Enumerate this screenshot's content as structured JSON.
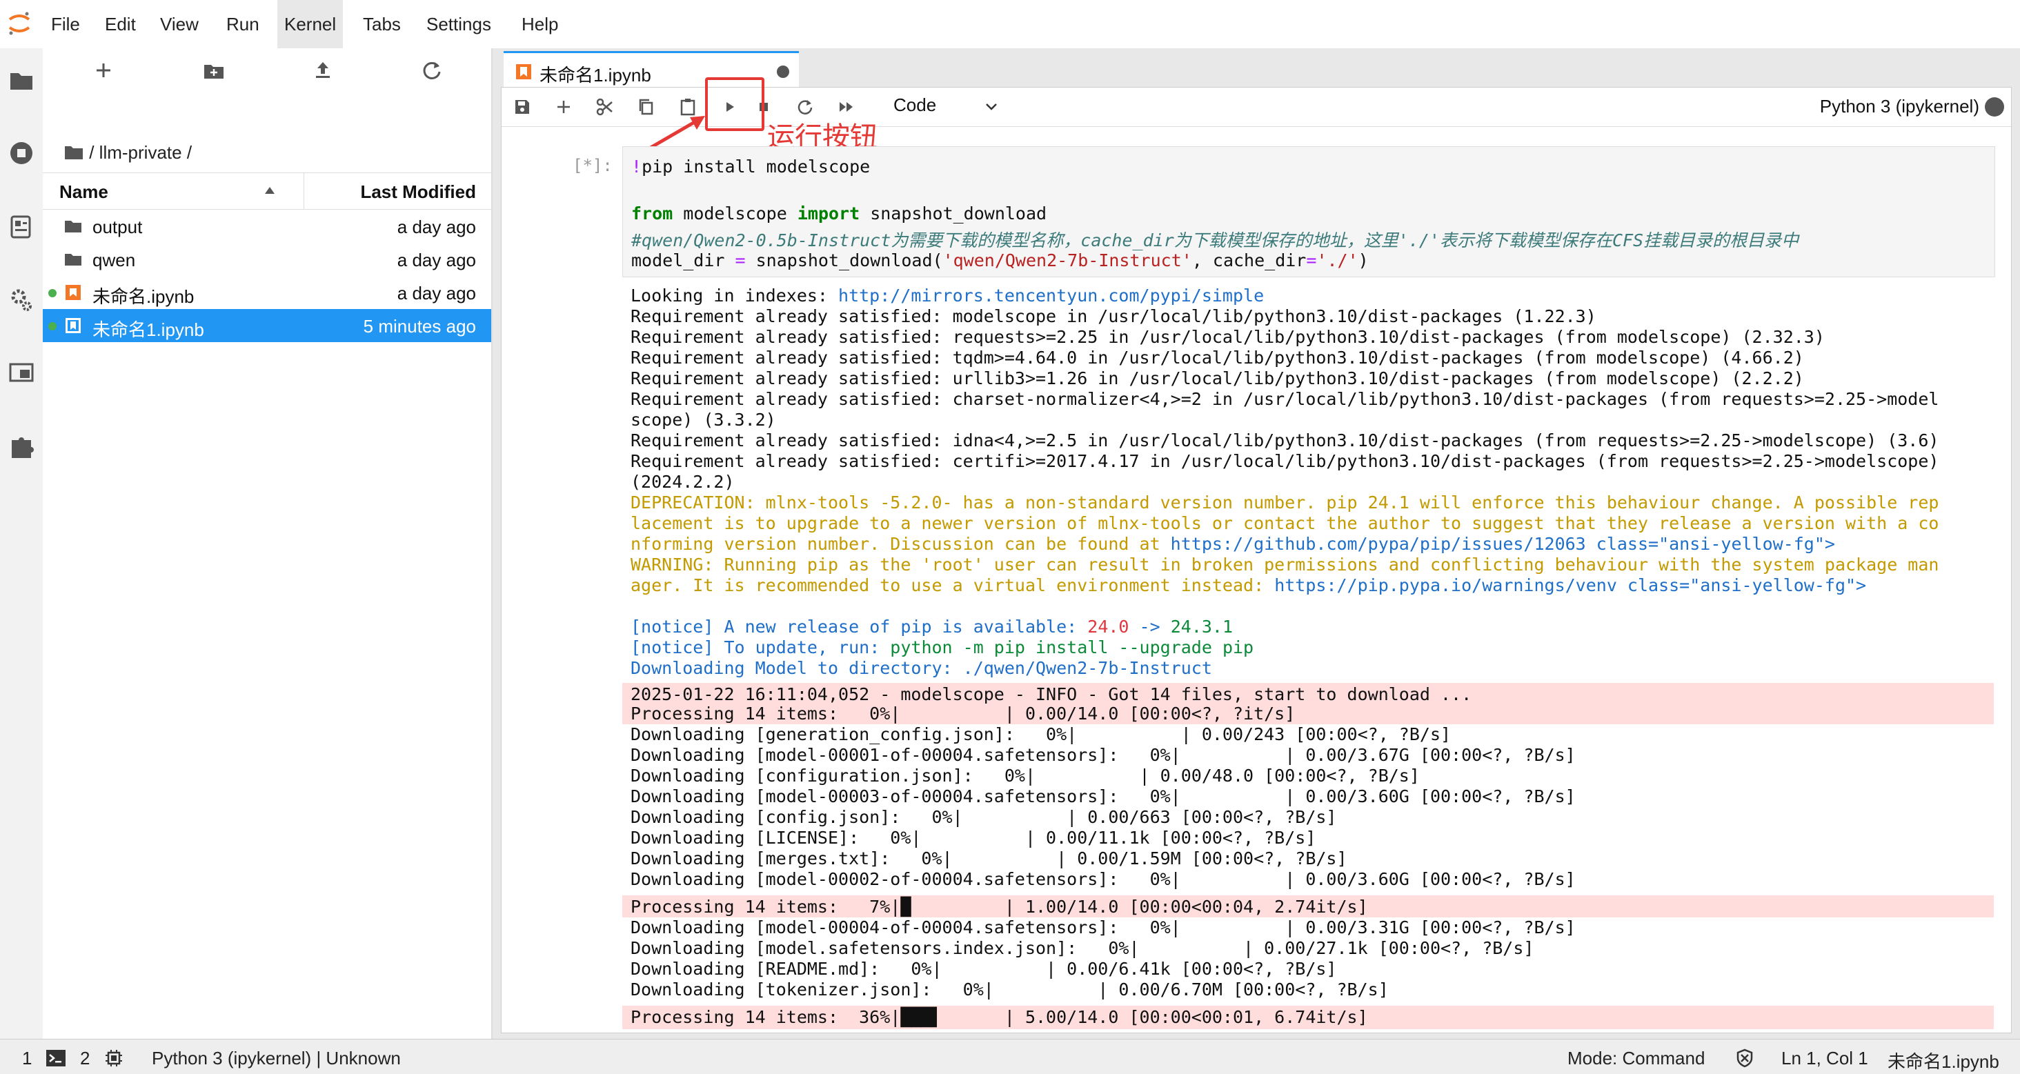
{
  "menubar": {
    "items": [
      "File",
      "Edit",
      "View",
      "Run",
      "Kernel",
      "Tabs",
      "Settings",
      "Help"
    ],
    "active": "Kernel"
  },
  "activitybar": {
    "icons": [
      "folder-icon",
      "running-icon",
      "commands-icon",
      "property-inspector-icon",
      "tabs-icon",
      "extensions-icon"
    ]
  },
  "filebrowser": {
    "breadcrumb": "/ llm-private /",
    "columns": {
      "name": "Name",
      "modified": "Last Modified"
    },
    "files": [
      {
        "name": "output",
        "modified": "a day ago",
        "type": "folder",
        "running": false,
        "selected": false
      },
      {
        "name": "qwen",
        "modified": "a day ago",
        "type": "folder",
        "running": false,
        "selected": false
      },
      {
        "name": "未命名.ipynb",
        "modified": "a day ago",
        "type": "notebook",
        "running": true,
        "selected": false
      },
      {
        "name": "未命名1.ipynb",
        "modified": "5 minutes ago",
        "type": "notebook",
        "running": true,
        "selected": true
      }
    ]
  },
  "notebook": {
    "tab_title": "未命名1.ipynb",
    "cell_type": "Code",
    "kernel_name": "Python 3 (ipykernel)",
    "annotation": "运行按钮",
    "prompt": "[*]:",
    "code": {
      "line1_bang": "!",
      "line1": "pip install modelscope",
      "line3_from": "from",
      "line3_mid": " modelscope ",
      "line3_import": "import",
      "line3_rest": " snapshot_download",
      "line4_comment": "#qwen/Qwen2-0.5b-Instruct为需要下载的模型名称，cache_dir为下载模型保存的地址，这里'./'表示将下载模型保存在CFS挂载目录的根目录中",
      "line5_a": "model_dir ",
      "line5_eq": "=",
      "line5_b": " snapshot_download(",
      "line5_str1": "'qwen/Qwen2-7b-Instruct'",
      "line5_c": ", cache_dir",
      "line5_eq2": "=",
      "line5_str2": "'./'",
      "line5_d": ")"
    },
    "output": {
      "indexes_prefix": "Looking in indexes: ",
      "indexes_url": "http://mirrors.tencentyun.com/pypi/simple",
      "req": [
        "Requirement already satisfied: modelscope in /usr/local/lib/python3.10/dist-packages (1.22.3)",
        "Requirement already satisfied: requests>=2.25 in /usr/local/lib/python3.10/dist-packages (from modelscope) (2.32.3)",
        "Requirement already satisfied: tqdm>=4.64.0 in /usr/local/lib/python3.10/dist-packages (from modelscope) (4.66.2)",
        "Requirement already satisfied: urllib3>=1.26 in /usr/local/lib/python3.10/dist-packages (from modelscope) (2.2.2)",
        "Requirement already satisfied: charset-normalizer<4,>=2 in /usr/local/lib/python3.10/dist-packages (from requests>=2.25->model",
        "scope) (3.3.2)",
        "Requirement already satisfied: idna<4,>=2.5 in /usr/local/lib/python3.10/dist-packages (from requests>=2.25->modelscope) (3.6)",
        "Requirement already satisfied: certifi>=2017.4.17 in /usr/local/lib/python3.10/dist-packages (from requests>=2.25->modelscope)",
        "(2024.2.2)"
      ],
      "deprecation": [
        "DEPRECATION: mlnx-tools -5.2.0- has a non-standard version number. pip 24.1 will enforce this behaviour change. A possible rep",
        "lacement is to upgrade to a newer version of mlnx-tools or contact the author to suggest that they release a version with a co",
        "nforming version number. Discussion can be found at "
      ],
      "deprecation_url": "https://github.com/pypa/pip/issues/12063 class=\"ansi-yellow-fg\">",
      "warning": [
        "WARNING: Running pip as the 'root' user can result in broken permissions and conflicting behaviour with the system package man",
        "ager. It is recommended to use a virtual environment instead: "
      ],
      "warning_url": "https://pip.pypa.io/warnings/venv class=\"ansi-yellow-fg\">",
      "notice_tag": "[notice]",
      "notice1_text": " A new release of pip is available: ",
      "notice1_old": "24.0",
      "notice1_arrow": " -> ",
      "notice1_new": "24.3.1",
      "notice2_text": " To update, run: ",
      "notice2_cmd": "python -m pip install --upgrade pip",
      "downloading_dir": "Downloading Model to directory: ./qwen/Qwen2-7b-Instruct",
      "band1": [
        "2025-01-22 16:11:04,052 - modelscope - INFO - Got 14 files, start to download ...",
        "Processing 14 items:   0%|          | 0.00/14.0 [00:00<?, ?it/s]"
      ],
      "dl1": [
        "Downloading [generation_config.json]:   0%|          | 0.00/243 [00:00<?, ?B/s]",
        "Downloading [model-00001-of-00004.safetensors]:   0%|          | 0.00/3.67G [00:00<?, ?B/s]",
        "Downloading [configuration.json]:   0%|          | 0.00/48.0 [00:00<?, ?B/s]",
        "Downloading [model-00003-of-00004.safetensors]:   0%|          | 0.00/3.60G [00:00<?, ?B/s]",
        "Downloading [config.json]:   0%|          | 0.00/663 [00:00<?, ?B/s]",
        "Downloading [LICENSE]:   0%|          | 0.00/11.1k [00:00<?, ?B/s]",
        "Downloading [merges.txt]:   0%|          | 0.00/1.59M [00:00<?, ?B/s]",
        "Downloading [model-00002-of-00004.safetensors]:   0%|          | 0.00/3.60G [00:00<?, ?B/s]"
      ],
      "band2": "Processing 14 items:   7%|█         | 1.00/14.0 [00:00<00:04, 2.74it/s]",
      "dl2": [
        "Downloading [model-00004-of-00004.safetensors]:   0%|          | 0.00/3.31G [00:00<?, ?B/s]",
        "Downloading [model.safetensors.index.json]:   0%|          | 0.00/27.1k [00:00<?, ?B/s]",
        "Downloading [README.md]:   0%|          | 0.00/6.41k [00:00<?, ?B/s]",
        "Downloading [tokenizer.json]:   0%|          | 0.00/6.70M [00:00<?, ?B/s]"
      ],
      "band3": "Processing 14 items:  36%|███▌      | 5.00/14.0 [00:00<00:01, 6.74it/s]"
    }
  },
  "statusbar": {
    "simple_toggle": "1",
    "terminals": "2",
    "kernel": "Python 3 (ipykernel) | Unknown",
    "mode": "Mode: Command",
    "position": "Ln 1, Col 1",
    "file": "未命名1.ipynb"
  },
  "colors": {
    "accent": "#2196f3",
    "annotation": "#e53935",
    "stderr_band": "#ffdddd"
  }
}
